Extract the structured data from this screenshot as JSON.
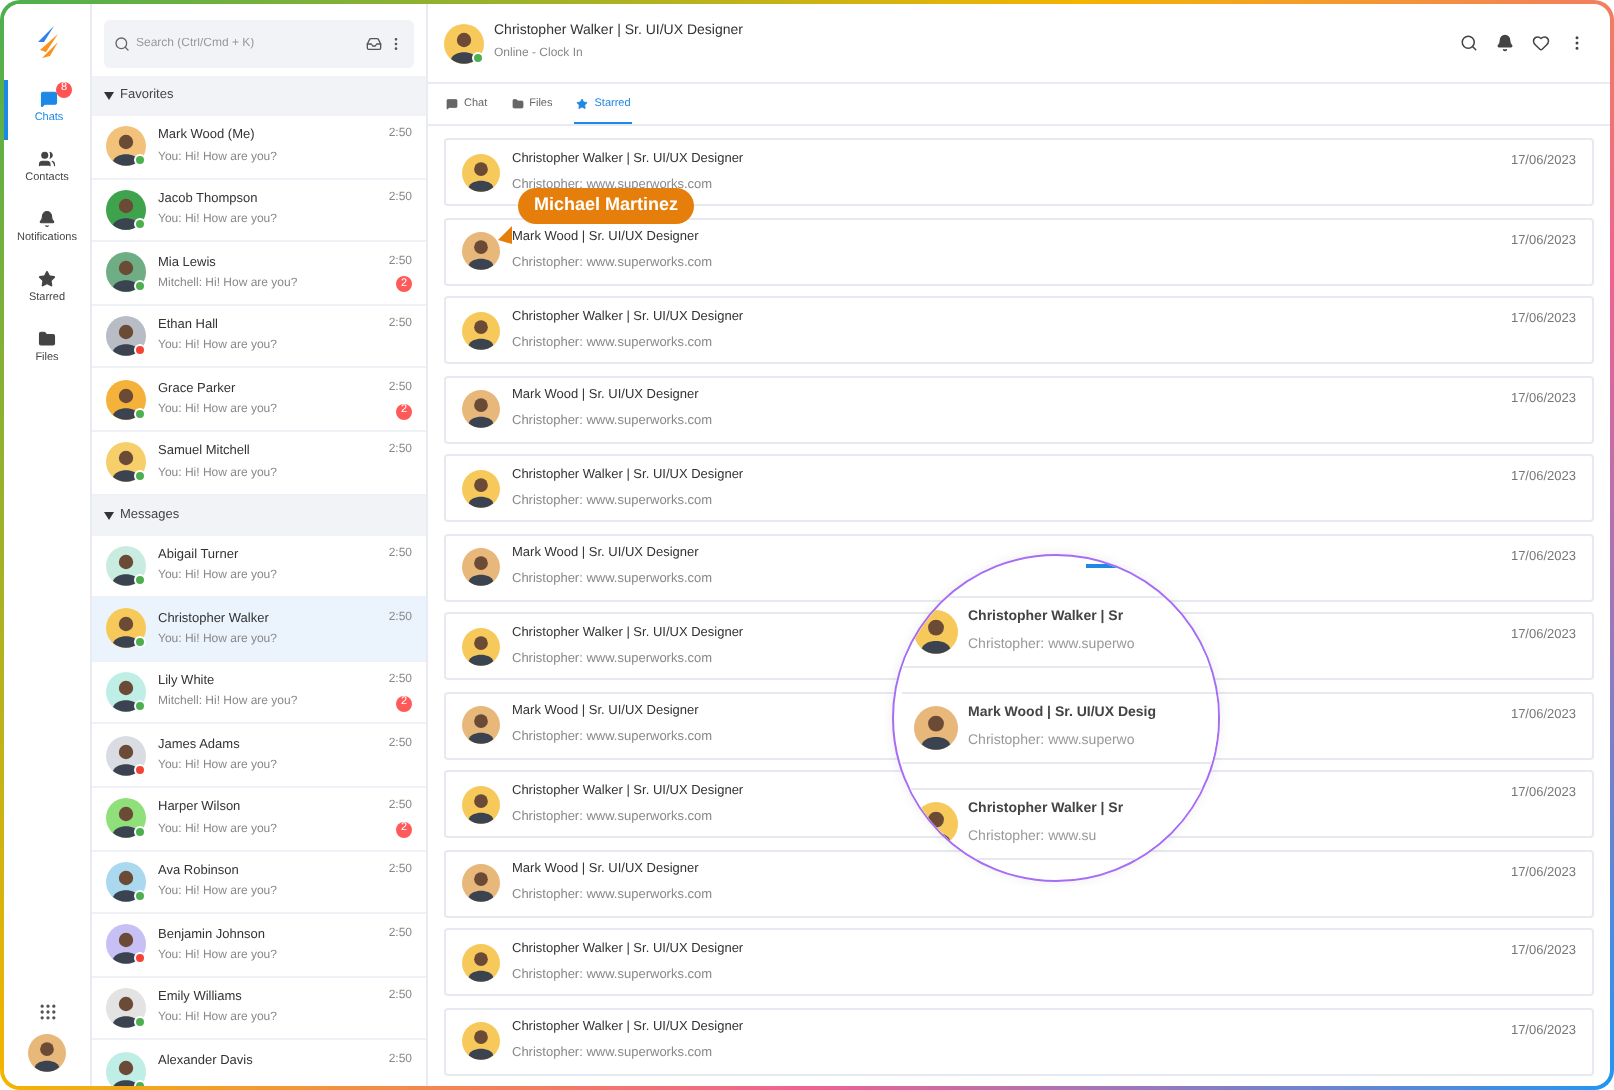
{
  "rail": {
    "items": [
      {
        "label": "Chats",
        "selected": true,
        "badge": "8",
        "kind": "chat"
      },
      {
        "label": "Contacts",
        "selected": false,
        "kind": "contacts"
      },
      {
        "label": "Notifications",
        "selected": false,
        "kind": "bell"
      },
      {
        "label": "Starred",
        "selected": false,
        "kind": "star"
      },
      {
        "label": "Files",
        "selected": false,
        "kind": "folder"
      }
    ]
  },
  "search": {
    "placeholder": "Search (Ctrl/Cmd + K)"
  },
  "sections": [
    {
      "title": "Favorites",
      "expanded": true,
      "chats": [
        {
          "name": "Mark Wood (Me)",
          "time": "2:50",
          "preview": "You: Hi! How are you?",
          "color": "#4caf50",
          "selected": false
        },
        {
          "name": "Jacob Thompson",
          "time": "2:50",
          "preview": "You: Hi! How are you?",
          "color": "#4caf50",
          "selected": false
        },
        {
          "name": "Mia Lewis",
          "time": "2:50",
          "preview": "Mitchell: Hi! How are you?",
          "color": "#4caf50",
          "badge": "2",
          "selected": false
        },
        {
          "name": "Ethan Hall",
          "time": "2:50",
          "preview": "You: Hi! How are you?",
          "color": "#f44336",
          "selected": false
        },
        {
          "name": "Grace Parker",
          "time": "2:50",
          "preview": "You: Hi! How are you?",
          "color": "#4caf50",
          "badge": "2",
          "selected": false
        },
        {
          "name": "Samuel Mitchell",
          "time": "2:50",
          "preview": "You: Hi! How are you?",
          "color": "#4caf50",
          "selected": false
        }
      ]
    },
    {
      "title": "Messages",
      "expanded": true,
      "chats": [
        {
          "name": "Abigail Turner",
          "time": "2:50",
          "preview": "You: Hi! How are you?",
          "color": "#4caf50",
          "selected": false
        },
        {
          "name": "Christopher Walker",
          "time": "2:50",
          "preview": "You: Hi! How are you?",
          "color": "#4caf50",
          "selected": true
        },
        {
          "name": "Lily White",
          "time": "2:50",
          "preview": "Mitchell: Hi! How are you?",
          "color": "#4caf50",
          "badge": "2",
          "selected": false
        },
        {
          "name": "James Adams",
          "time": "2:50",
          "preview": "You: Hi! How are you?",
          "color": "#f44336",
          "selected": false
        },
        {
          "name": "Harper Wilson",
          "time": "2:50",
          "preview": "You: Hi! How are you?",
          "color": "#4caf50",
          "badge": "2",
          "selected": false
        },
        {
          "name": "Ava Robinson",
          "time": "2:50",
          "preview": "You: Hi! How are you?",
          "color": "#4caf50",
          "selected": false
        },
        {
          "name": "Benjamin Johnson",
          "time": "2:50",
          "preview": "You: Hi! How are you?",
          "color": "#f44336",
          "selected": false
        },
        {
          "name": "Emily Williams",
          "time": "2:50",
          "preview": "You: Hi! How are you?",
          "color": "#4caf50",
          "selected": false
        },
        {
          "name": "Alexander Davis",
          "time": "2:50",
          "color": "#4caf50",
          "selected": false
        }
      ]
    }
  ],
  "header": {
    "name": "Christopher Walker | Sr. UI/UX Designer",
    "status_text": "Online - Clock In",
    "color": "#4caf50"
  },
  "tabs": [
    {
      "label": "Chat",
      "selected": false,
      "kind": "chat"
    },
    {
      "label": "Files",
      "selected": false,
      "kind": "folder"
    },
    {
      "label": "Starred",
      "selected": true,
      "kind": "star"
    }
  ],
  "starred": [
    {
      "title": "Christopher Walker | Sr. UI/UX Designer",
      "subtitle": "Christopher: www.superworks.com",
      "date": "17/06/2023",
      "color": "#f7c95a"
    },
    {
      "title": "Mark Wood | Sr. UI/UX Designer",
      "subtitle": "Christopher: www.superworks.com",
      "date": "17/06/2023",
      "color": "#e8b77a"
    },
    {
      "title": "Christopher Walker | Sr. UI/UX Designer",
      "subtitle": "Christopher: www.superworks.com",
      "date": "17/06/2023",
      "color": "#f7c95a"
    },
    {
      "title": "Mark Wood | Sr. UI/UX Designer",
      "subtitle": "Christopher: www.superworks.com",
      "date": "17/06/2023",
      "color": "#e8b77a"
    },
    {
      "title": "Christopher Walker | Sr. UI/UX Designer",
      "subtitle": "Christopher: www.superworks.com",
      "date": "17/06/2023",
      "color": "#f7c95a"
    },
    {
      "title": "Mark Wood | Sr. UI/UX Designer",
      "subtitle": "Christopher: www.superworks.com",
      "date": "17/06/2023",
      "color": "#e8b77a"
    },
    {
      "title": "Christopher Walker | Sr. UI/UX Designer",
      "subtitle": "Christopher: www.superworks.com",
      "date": "17/06/2023",
      "color": "#f7c95a"
    },
    {
      "title": "Mark Wood | Sr. UI/UX Designer",
      "subtitle": "Christopher: www.superworks.com",
      "date": "17/06/2023",
      "color": "#e8b77a"
    },
    {
      "title": "Christopher Walker | Sr. UI/UX Designer",
      "subtitle": "Christopher: www.superworks.com",
      "date": "17/06/2023",
      "color": "#f7c95a"
    },
    {
      "title": "Mark Wood | Sr. UI/UX Designer",
      "subtitle": "Christopher: www.superworks.com",
      "date": "17/06/2023",
      "color": "#e8b77a"
    },
    {
      "title": "Christopher Walker | Sr. UI/UX Designer",
      "subtitle": "Christopher: www.superworks.com",
      "date": "17/06/2023",
      "color": "#f7c95a"
    },
    {
      "title": "Christopher Walker | Sr. UI/UX Designer",
      "subtitle": "Christopher: www.superworks.com",
      "date": "17/06/2023",
      "color": "#f7c95a"
    }
  ],
  "tooltip": {
    "text": "Michael Martinez"
  },
  "magnifier": {
    "rows": [
      {
        "title": "Christopher Walker | Sr",
        "subtitle": "Christopher: www.superwo",
        "color": "#f7c95a"
      },
      {
        "title": "Mark Wood | Sr. UI/UX Desig",
        "subtitle": "Christopher: www.superwo",
        "color": "#e8b77a"
      },
      {
        "title": "Christopher Walker | Sr",
        "subtitle": "Christopher: www.su",
        "color": "#f7c95a"
      }
    ]
  }
}
